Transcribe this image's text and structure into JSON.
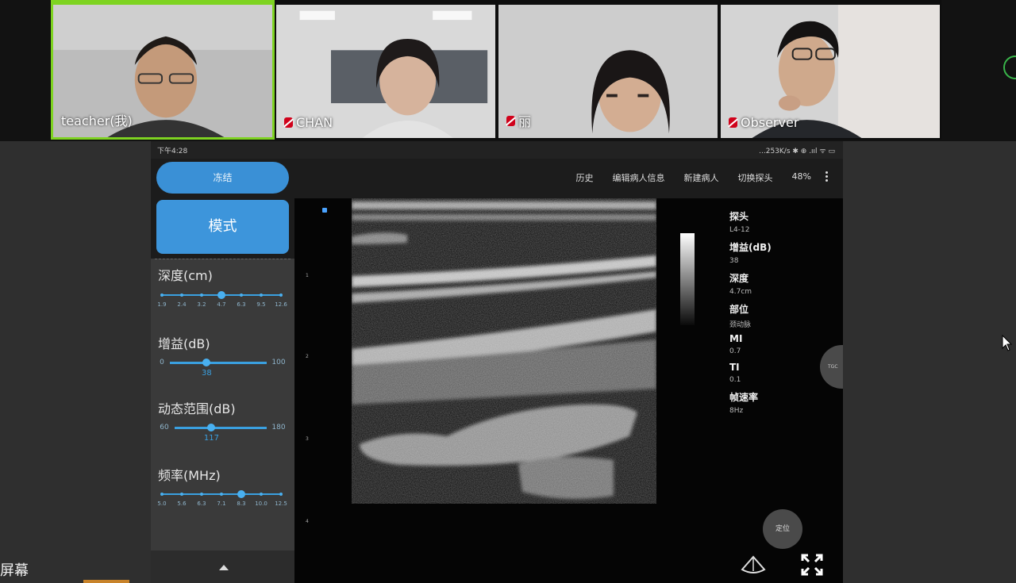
{
  "participants": [
    {
      "name": "teacher(我)",
      "active": true,
      "muted": false
    },
    {
      "name": "CHAN",
      "active": false,
      "muted": true
    },
    {
      "name": "丽",
      "active": false,
      "muted": true
    },
    {
      "name": "Observer",
      "active": false,
      "muted": true
    }
  ],
  "share_label": "屏幕",
  "status_bar": {
    "time": "下午4:28",
    "right": "...253K/s ✱ ⊕ .ııl ᯤ ▭"
  },
  "toolbar": {
    "items": [
      "历史",
      "编辑病人信息",
      "新建病人",
      "切换探头",
      "48%"
    ]
  },
  "left_panel": {
    "freeze_label": "冻结",
    "mode_label": "模式",
    "controls": [
      {
        "label": "深度(cm)",
        "ticks": [
          "1.9",
          "2.4",
          "3.2",
          "4.7",
          "6.3",
          "9.5",
          "12.6"
        ],
        "selected_index": 3
      },
      {
        "label": "增益(dB)",
        "min": "0",
        "max": "100",
        "value": "38",
        "fraction": 0.38
      },
      {
        "label": "动态范围(dB)",
        "min": "60",
        "max": "180",
        "value": "117",
        "fraction": 0.4
      },
      {
        "label": "频率(MHz)",
        "ticks": [
          "5.0",
          "5.6",
          "6.3",
          "7.1",
          "8.3",
          "10.0",
          "12.5"
        ],
        "selected_index": 4
      }
    ]
  },
  "depth_ticks": [
    "1",
    "2",
    "3",
    "4"
  ],
  "params": [
    {
      "label": "探头",
      "value": "L4-12"
    },
    {
      "label": "增益(dB)",
      "value": "38"
    },
    {
      "label": "深度",
      "value": "4.7cm"
    },
    {
      "label": "部位",
      "value": "颈动脉"
    },
    {
      "label": "MI",
      "value": "0.7"
    },
    {
      "label": "TI",
      "value": "0.1"
    },
    {
      "label": "帧速率",
      "value": "8Hz"
    }
  ],
  "right_tab_label": "TGC",
  "locate_label": "定位",
  "colors": {
    "accent": "#3d95db",
    "active_border": "#7ed321",
    "mute": "#d0021b"
  }
}
